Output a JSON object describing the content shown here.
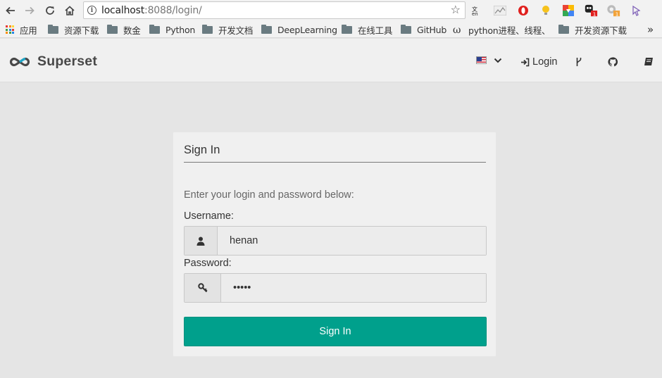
{
  "browser": {
    "url_host": "localhost",
    "url_rest": ":8088/login/",
    "bookmarks": [
      {
        "label": "应用",
        "type": "apps"
      },
      {
        "label": "资源下载",
        "type": "folder"
      },
      {
        "label": "数金",
        "type": "folder"
      },
      {
        "label": "Python",
        "type": "folder"
      },
      {
        "label": "开发文档",
        "type": "folder"
      },
      {
        "label": "DeepLearning",
        "type": "folder"
      },
      {
        "label": "在线工具",
        "type": "folder"
      },
      {
        "label": "GitHub",
        "type": "folder"
      },
      {
        "label": "python进程、线程、",
        "type": "page"
      },
      {
        "label": "开发资源下载",
        "type": "folder"
      }
    ],
    "overflow_label": "»",
    "extension_badge_red": "1",
    "extension_badge_orange": "1"
  },
  "navbar": {
    "brand": "Superset",
    "login_label": "Login",
    "language_icon": "us-flag-icon",
    "colors": {
      "brand_accent": "#484848",
      "logo_teal": "#20a7c9"
    }
  },
  "login": {
    "title": "Sign In",
    "hint": "Enter your login and password below:",
    "username_label": "Username:",
    "username_value": "henan",
    "password_label": "Password:",
    "password_value": "•••••",
    "submit_label": "Sign In",
    "colors": {
      "submit_bg": "#00a08c"
    }
  }
}
